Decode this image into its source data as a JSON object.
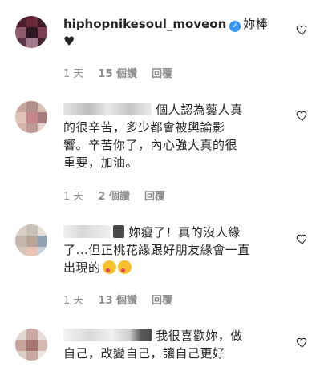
{
  "comments": [
    {
      "username": "hiphopnikesoul_moveon",
      "text": "妳棒",
      "line2": "♥",
      "time": "1 天",
      "likes": "15 個讚",
      "reply": "回覆",
      "verified": true
    },
    {
      "text_lines": [
        "個人認為藝人真",
        "的很辛苦，多少都會被輿論影",
        "響。辛苦你了，內心強大真的很",
        "重要，加油。"
      ],
      "time": "1 天",
      "likes": "2 個讚",
      "reply": "回覆"
    },
    {
      "text_lines": [
        "妳瘦了！真的沒人緣",
        "了...但正桃花緣跟好朋友緣會一直",
        "出現的"
      ],
      "time": "1 天",
      "likes": "13 個讚",
      "reply": "回覆"
    },
    {
      "text_lines": [
        "我很喜歡妳，做",
        "自己，改變自己，讓自己更好"
      ]
    }
  ],
  "icons": {
    "verified": "verified-badge-icon",
    "like": "heart-outline-icon",
    "emoji": "kissing-face-emoji"
  }
}
